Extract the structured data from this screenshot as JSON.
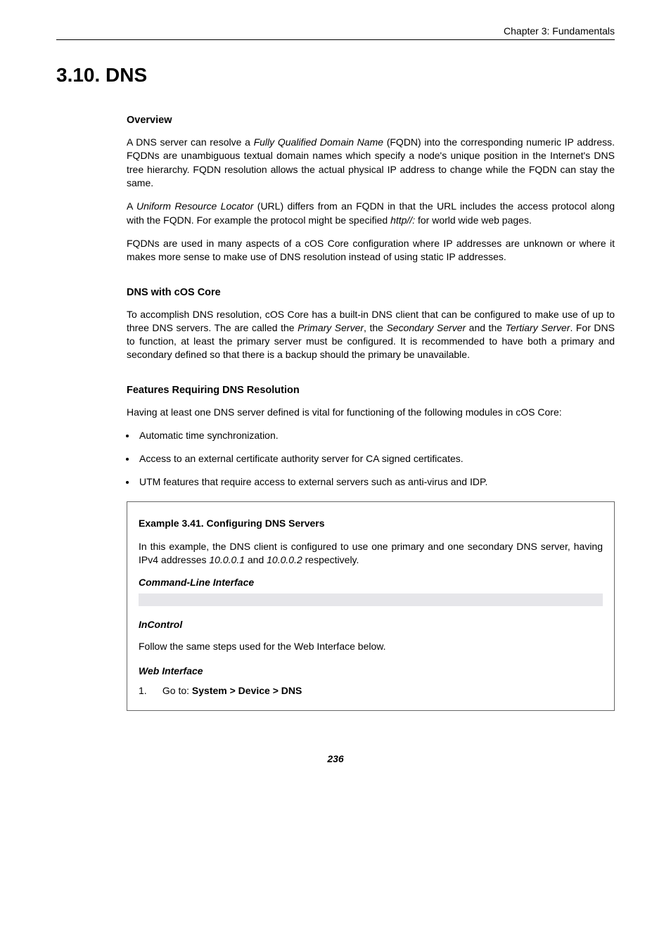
{
  "header": {
    "chapter": "Chapter 3: Fundamentals"
  },
  "section": {
    "title": "3.10. DNS"
  },
  "overview": {
    "heading": "Overview",
    "p1_a": "A DNS server can resolve a ",
    "p1_b": "Fully Qualified Domain Name",
    "p1_c": " (FQDN) into the corresponding numeric IP address. FQDNs are unambiguous textual domain names which specify a node's unique position in the Internet's DNS tree hierarchy. FQDN resolution allows the actual physical IP address to change while the FQDN can stay the same.",
    "p2_a": "A ",
    "p2_b": "Uniform Resource Locator",
    "p2_c": " (URL) differs from an FQDN in that the URL includes the access protocol along with the FQDN. For example the protocol might be specified ",
    "p2_d": "http//:",
    "p2_e": " for world wide web pages.",
    "p3": "FQDNs are used in many aspects of a cOS Core configuration where IP addresses are unknown or where it makes more sense to make use of DNS resolution instead of using static IP addresses."
  },
  "dns_cos": {
    "heading": "DNS with cOS Core",
    "p1_a": "To accomplish DNS resolution, cOS Core has a built-in DNS client that can be configured to make use of up to three DNS servers. The are called the ",
    "p1_b": "Primary Server",
    "p1_c": ", the ",
    "p1_d": "Secondary Server",
    "p1_e": " and the ",
    "p1_f": "Tertiary Server",
    "p1_g": ". For DNS to function, at least the primary server must be configured. It is recommended to have both a primary and secondary defined so that there is a backup should the primary be unavailable."
  },
  "features": {
    "heading": "Features Requiring DNS Resolution",
    "p1": "Having at least one DNS server defined is vital for functioning of the following modules in cOS Core:",
    "items": [
      "Automatic time synchronization.",
      "Access to an external certificate authority server for CA signed certificates.",
      "UTM features that require access to external servers such as anti-virus and IDP."
    ]
  },
  "example": {
    "title": "Example 3.41. Configuring DNS Servers",
    "p1_a": "In this example, the DNS client is configured to use one primary and one secondary DNS server, having IPv4 addresses ",
    "p1_b": "10.0.0.1",
    "p1_c": " and ",
    "p1_d": "10.0.0.2",
    "p1_e": " respectively.",
    "cli_label": "Command-Line Interface",
    "incontrol_label": "InControl",
    "incontrol_text": "Follow the same steps used for the Web Interface below.",
    "web_label": "Web Interface",
    "step_num": "1.",
    "step_prefix": "Go to: ",
    "step_bold": "System > Device > DNS"
  },
  "footer": {
    "page": "236"
  }
}
